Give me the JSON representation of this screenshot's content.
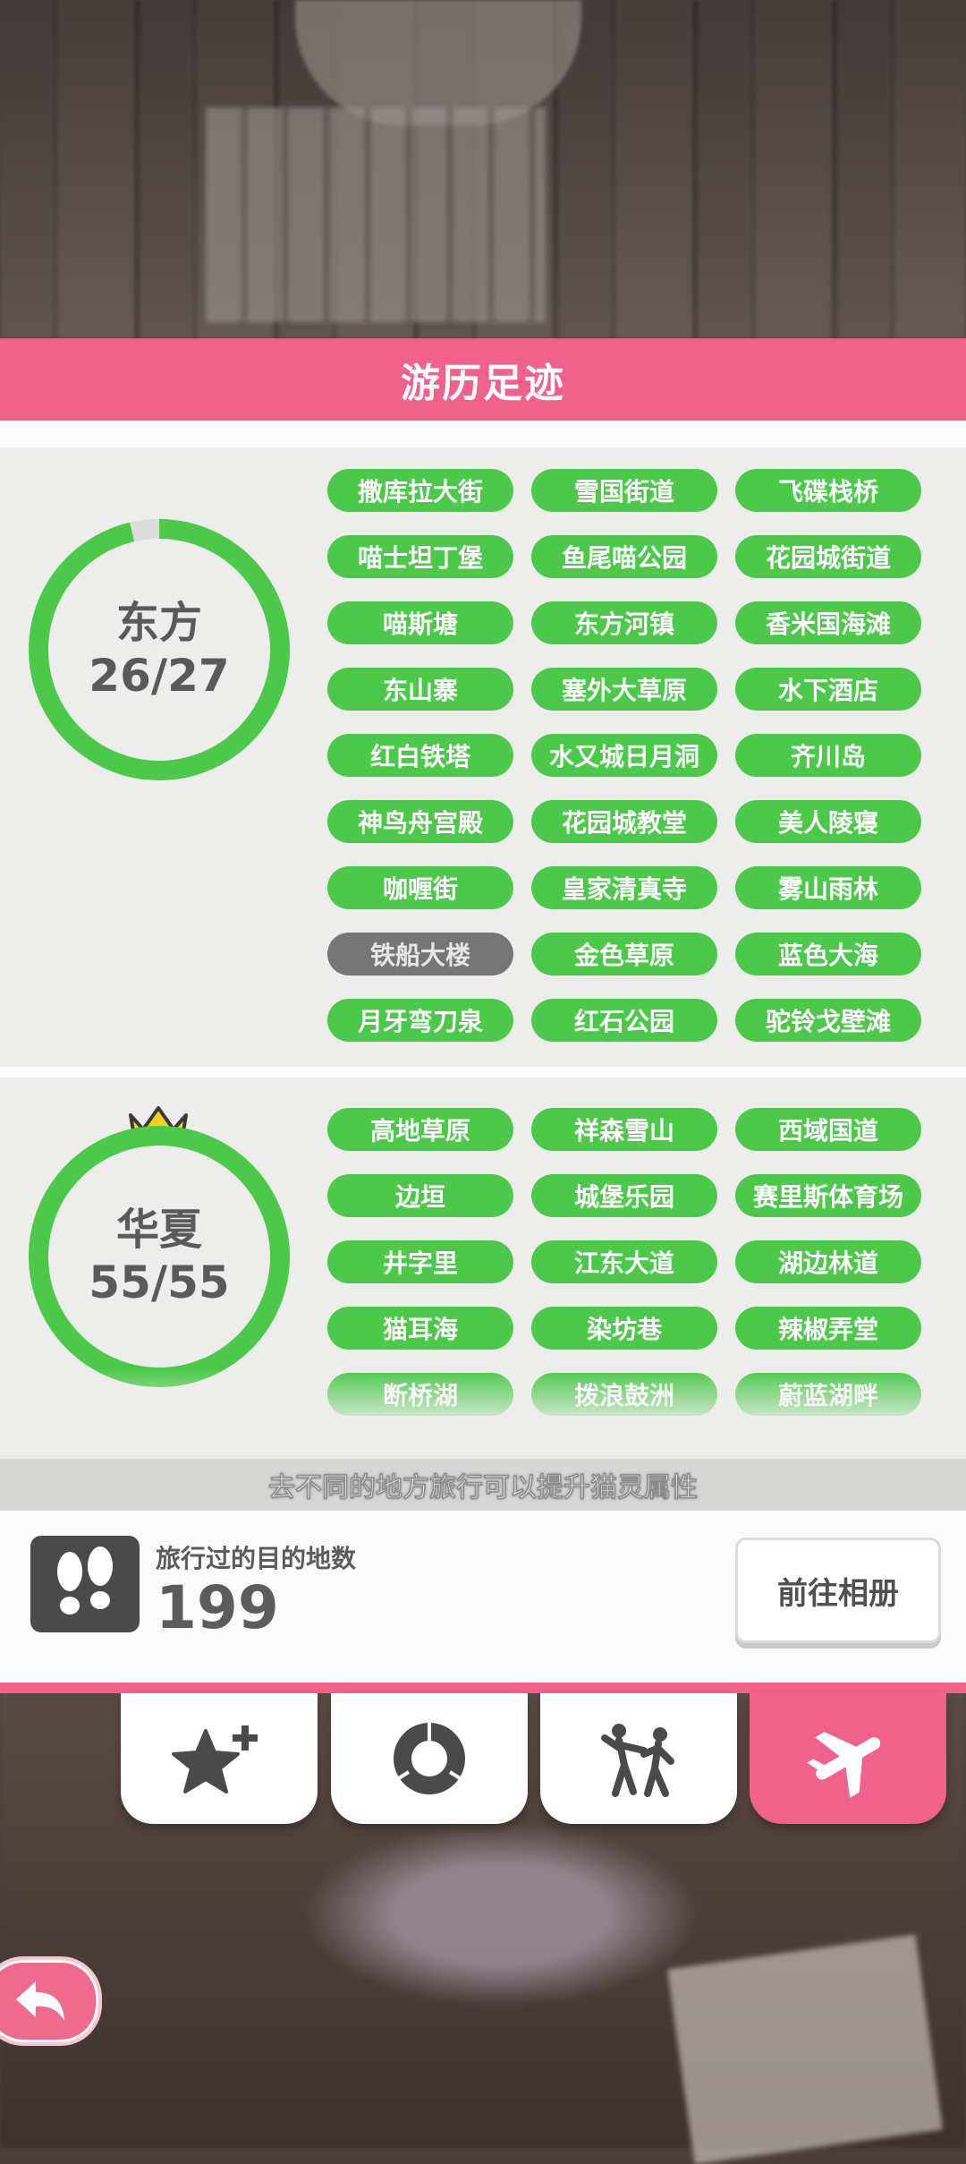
{
  "header": {
    "title": "游历足迹"
  },
  "regions": [
    {
      "name": "东方",
      "count": "26/27",
      "progress": 0.963,
      "crown": false,
      "places": [
        {
          "label": "撒库拉大街",
          "visited": true
        },
        {
          "label": "雪国街道",
          "visited": true
        },
        {
          "label": "飞碟栈桥",
          "visited": true
        },
        {
          "label": "喵士坦丁堡",
          "visited": true
        },
        {
          "label": "鱼尾喵公园",
          "visited": true
        },
        {
          "label": "花园城街道",
          "visited": true
        },
        {
          "label": "喵斯塘",
          "visited": true
        },
        {
          "label": "东方河镇",
          "visited": true
        },
        {
          "label": "香米国海滩",
          "visited": true
        },
        {
          "label": "东山寨",
          "visited": true
        },
        {
          "label": "塞外大草原",
          "visited": true
        },
        {
          "label": "水下酒店",
          "visited": true
        },
        {
          "label": "红白铁塔",
          "visited": true
        },
        {
          "label": "水又城日月洞",
          "visited": true
        },
        {
          "label": "齐川岛",
          "visited": true
        },
        {
          "label": "神鸟舟宫殿",
          "visited": true
        },
        {
          "label": "花园城教堂",
          "visited": true
        },
        {
          "label": "美人陵寝",
          "visited": true
        },
        {
          "label": "咖喱街",
          "visited": true
        },
        {
          "label": "皇家清真寺",
          "visited": true
        },
        {
          "label": "雾山雨林",
          "visited": true
        },
        {
          "label": "铁船大楼",
          "visited": false
        },
        {
          "label": "金色草原",
          "visited": true
        },
        {
          "label": "蓝色大海",
          "visited": true
        },
        {
          "label": "月牙弯刀泉",
          "visited": true
        },
        {
          "label": "红石公园",
          "visited": true
        },
        {
          "label": "驼铃戈壁滩",
          "visited": true
        }
      ]
    },
    {
      "name": "华夏",
      "count": "55/55",
      "progress": 1.0,
      "crown": true,
      "places": [
        {
          "label": "高地草原",
          "visited": true
        },
        {
          "label": "祥森雪山",
          "visited": true
        },
        {
          "label": "西域国道",
          "visited": true
        },
        {
          "label": "边垣",
          "visited": true
        },
        {
          "label": "城堡乐园",
          "visited": true
        },
        {
          "label": "赛里斯体育场",
          "visited": true
        },
        {
          "label": "井字里",
          "visited": true
        },
        {
          "label": "江东大道",
          "visited": true
        },
        {
          "label": "湖边林道",
          "visited": true
        },
        {
          "label": "猫耳海",
          "visited": true
        },
        {
          "label": "染坊巷",
          "visited": true
        },
        {
          "label": "辣椒弄堂",
          "visited": true
        },
        {
          "label": "断桥湖",
          "visited": true
        },
        {
          "label": "拨浪鼓洲",
          "visited": true
        },
        {
          "label": "蔚蓝湖畔",
          "visited": true
        }
      ]
    }
  ],
  "hint": "去不同的地方旅行可以提升猫灵属性",
  "stats": {
    "label": "旅行过的目的地数",
    "value": "199"
  },
  "album_button": "前往相册",
  "tabs": [
    {
      "icon": "star-plus-icon",
      "active": false
    },
    {
      "icon": "donut-chart-icon",
      "active": false
    },
    {
      "icon": "people-fight-icon",
      "active": false
    },
    {
      "icon": "airplane-icon",
      "active": true
    }
  ],
  "colors": {
    "pink": "#f0628b",
    "green": "#4cc94b",
    "locked": "#767676",
    "ring_track": "#dcdcdc"
  }
}
